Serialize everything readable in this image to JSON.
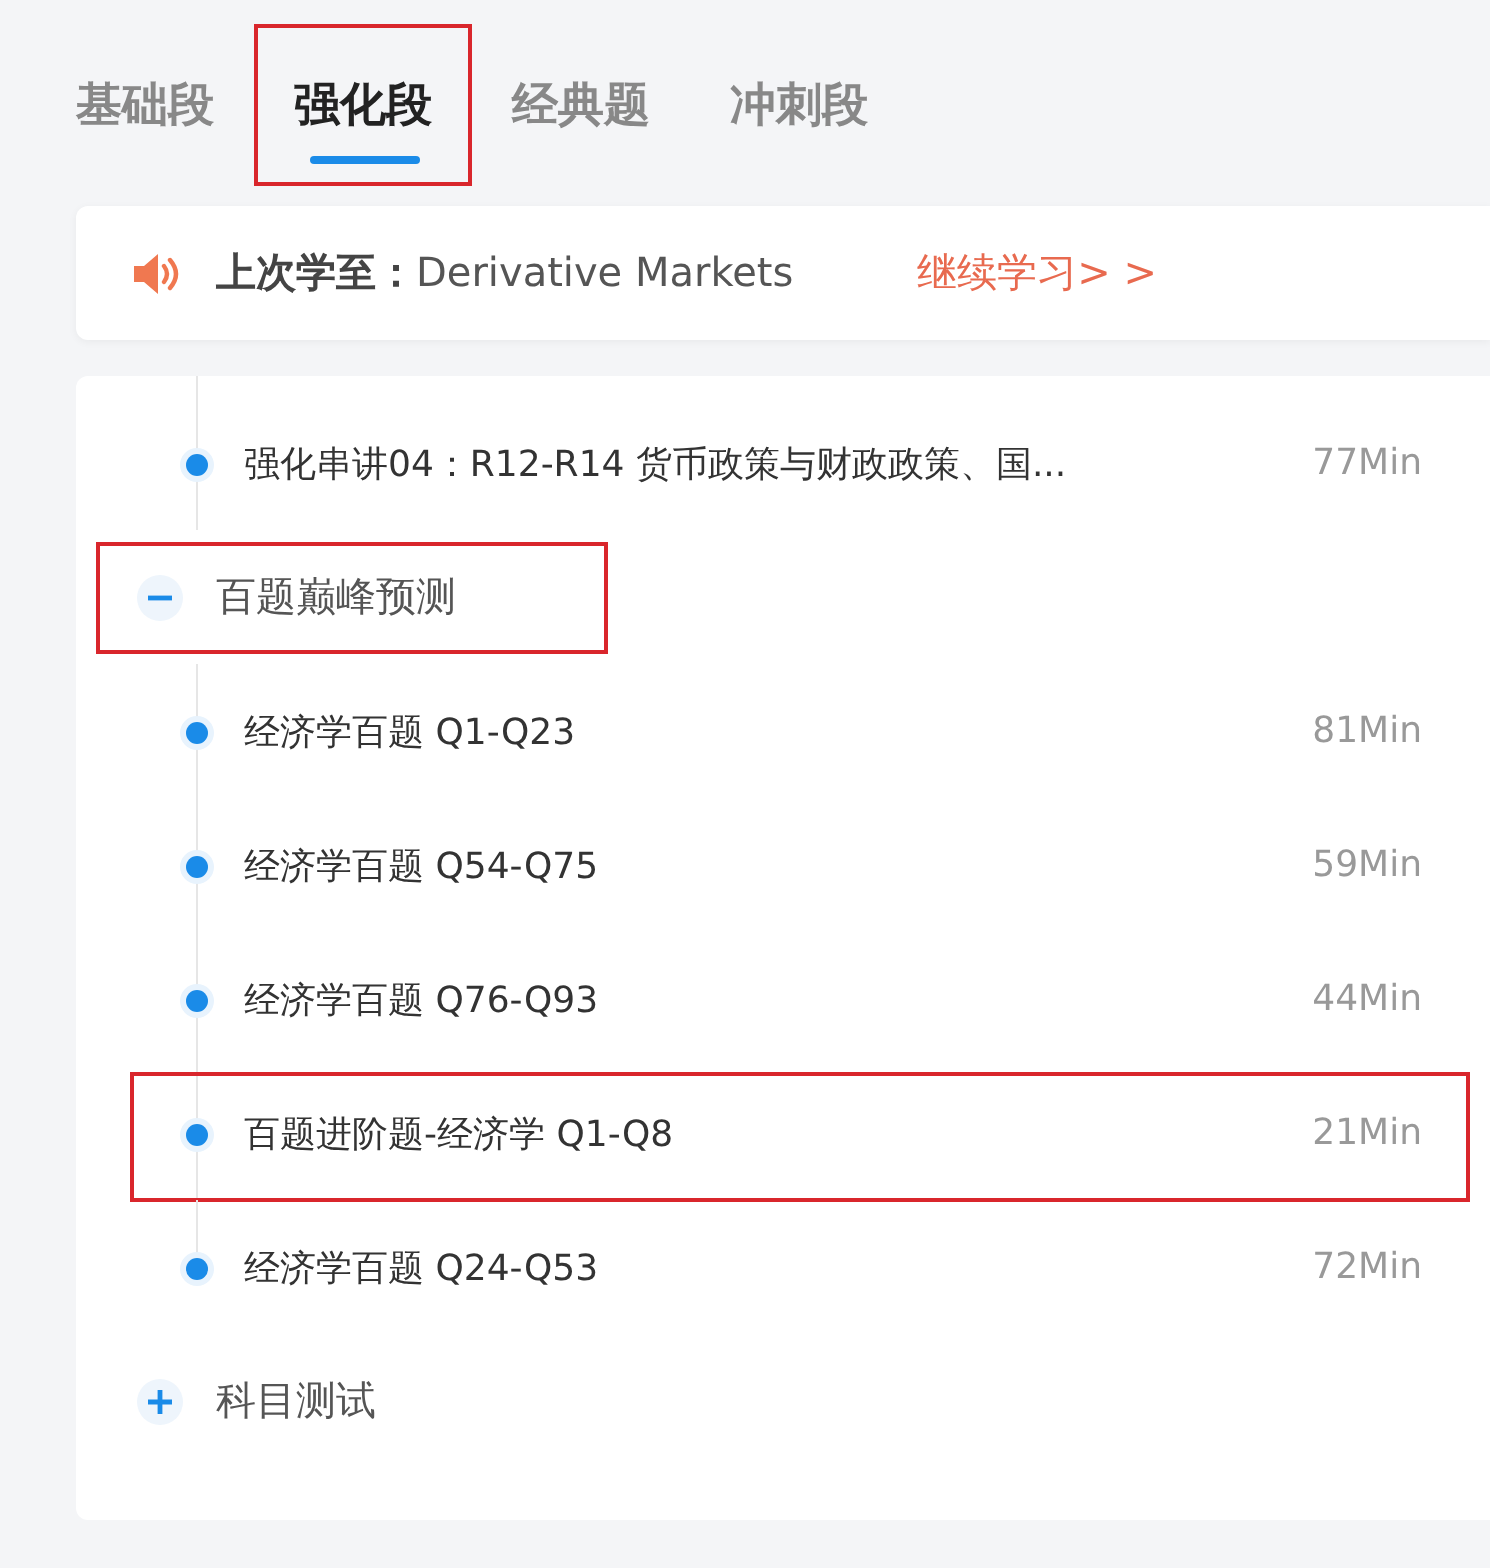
{
  "tabs": [
    {
      "label": "基础段",
      "selected": false,
      "highlighted": false
    },
    {
      "label": "强化段",
      "selected": true,
      "highlighted": true
    },
    {
      "label": "经典题",
      "selected": false,
      "highlighted": false
    },
    {
      "label": "冲刺段",
      "selected": false,
      "highlighted": false
    }
  ],
  "resume": {
    "text": "**上次学至：**Derivative Markets",
    "link": "继续学习> >"
  },
  "outline": [
    {
      "kind": "lesson",
      "title": "强化串讲04：R12-R14 货币政策与财政政策、国...",
      "duration": "77Min",
      "highlighted": false
    },
    {
      "kind": "group",
      "title": "百题巅峰预测",
      "expanded": true,
      "highlighted": true,
      "children": [
        {
          "kind": "lesson",
          "title": "经济学百题 Q1-Q23",
          "duration": "81Min",
          "highlighted": false
        },
        {
          "kind": "lesson",
          "title": "经济学百题 Q54-Q75",
          "duration": "59Min",
          "highlighted": false
        },
        {
          "kind": "lesson",
          "title": "经济学百题 Q76-Q93",
          "duration": "44Min",
          "highlighted": false
        },
        {
          "kind": "lesson",
          "title": "百题进阶题-经济学 Q1-Q8",
          "duration": "21Min",
          "highlighted": true
        },
        {
          "kind": "lesson",
          "title": "经济学百题 Q24-Q53",
          "duration": "72Min",
          "highlighted": false
        }
      ]
    },
    {
      "kind": "group",
      "title": "科目测试",
      "expanded": false,
      "highlighted": false
    }
  ]
}
